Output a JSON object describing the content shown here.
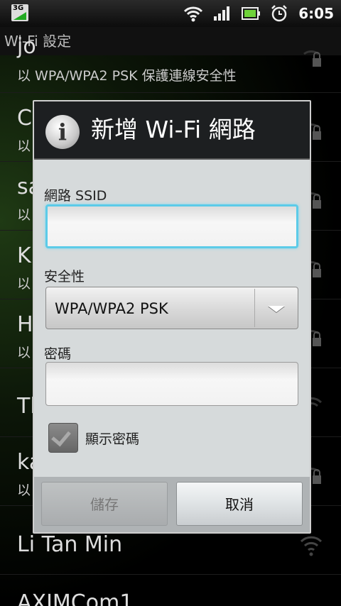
{
  "status_bar": {
    "network_label": "3G",
    "time": "6:05",
    "icons": [
      "wifi-signal-icon",
      "cell-signal-icon",
      "battery-icon",
      "alarm-clock-icon"
    ]
  },
  "title_bar": {
    "title": "Wi-Fi 設定"
  },
  "background_list": [
    {
      "name": "jo",
      "subtitle": "以 WPA/WPA2 PSK 保護連線安全性",
      "icon": "wifi-lock-icon"
    },
    {
      "name": "C",
      "subtitle": "以",
      "icon": "wifi-lock-icon"
    },
    {
      "name": "sa",
      "subtitle": "以",
      "icon": "wifi-lock-icon"
    },
    {
      "name": "K",
      "subtitle": "以",
      "icon": "wifi-lock-icon"
    },
    {
      "name": "H",
      "subtitle": "以",
      "icon": "wifi-lock-icon"
    },
    {
      "name": "Tl",
      "subtitle": "",
      "icon": "wifi-icon"
    },
    {
      "name": "ka",
      "subtitle": "以",
      "icon": "wifi-lock-icon"
    },
    {
      "name": "Li Tan Min",
      "subtitle": "",
      "icon": "wifi-icon"
    },
    {
      "name": "AXIMCom1",
      "subtitle": "",
      "icon": "wifi-icon"
    }
  ],
  "dialog": {
    "title": "新增 Wi-Fi 網路",
    "ssid_label": "網路 SSID",
    "ssid_value": "",
    "security_label": "安全性",
    "security_value": "WPA/WPA2 PSK",
    "password_label": "密碼",
    "password_value": "",
    "show_password_label": "顯示密碼",
    "show_password_checked": true,
    "save_label": "儲存",
    "cancel_label": "取消"
  },
  "colors": {
    "focus_border": "#5ccbe8",
    "dialog_bg": "#d6dadb",
    "header_bg": "#1d1f21"
  }
}
